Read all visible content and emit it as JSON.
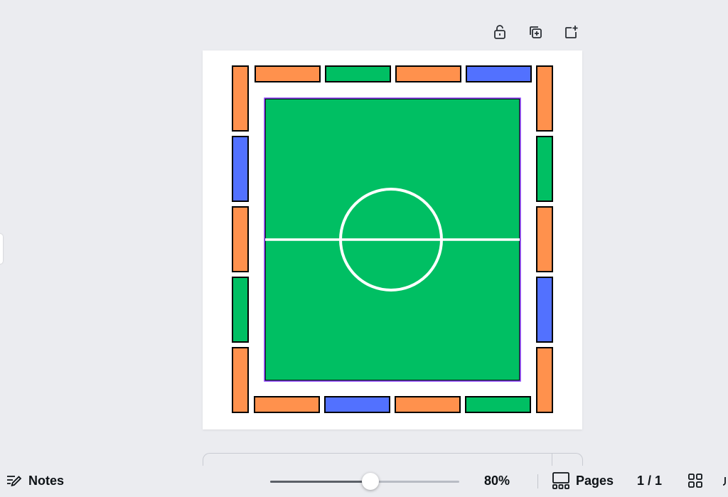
{
  "page_actions": {
    "lock_icon": "unlock-icon",
    "duplicate_icon": "duplicate-page-icon",
    "add_icon": "add-page-icon"
  },
  "canvas": {
    "colors": {
      "orange": "#ff914d",
      "green": "#00bf63",
      "blue": "#5271ff",
      "field": "#00bf63",
      "line": "#ffffff",
      "selection": "#8b3dff",
      "outline": "#000000"
    },
    "border_tiles": {
      "top": [
        "orange",
        "green",
        "orange",
        "blue"
      ],
      "bottom": [
        "orange",
        "blue",
        "orange",
        "green"
      ],
      "left": [
        "orange",
        "blue",
        "orange",
        "green",
        "orange"
      ],
      "right": [
        "orange",
        "green",
        "orange",
        "blue",
        "orange"
      ]
    }
  },
  "footer": {
    "notes_label": "Notes",
    "zoom_value": "80%",
    "zoom_fraction": 0.53,
    "pages_label": "Pages",
    "page_count": "1 / 1"
  }
}
